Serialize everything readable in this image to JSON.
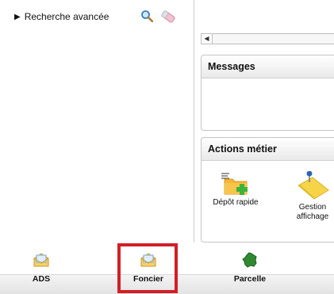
{
  "search": {
    "label": "Recherche avancée"
  },
  "messages": {
    "title": "Messages"
  },
  "actions": {
    "title": "Actions métier",
    "items": [
      {
        "label": "Dépôt rapide"
      },
      {
        "label": "Gestion affichage"
      }
    ]
  },
  "tabs": [
    {
      "label": "ADS"
    },
    {
      "label": "Foncier",
      "highlighted": true
    },
    {
      "label": "Parcelle"
    }
  ],
  "colors": {
    "highlight": "#d11f26"
  }
}
